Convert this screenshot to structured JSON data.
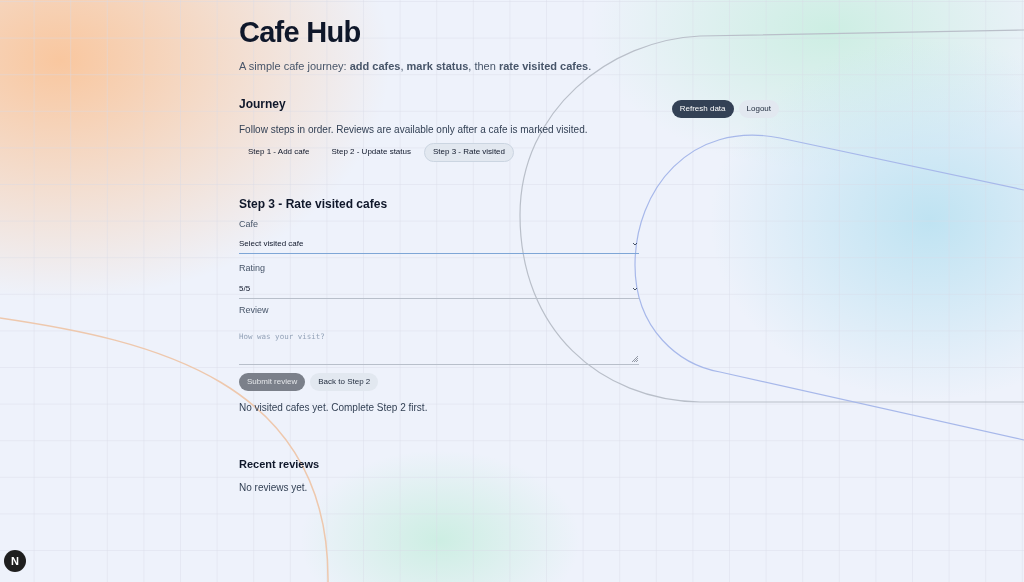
{
  "title": "Cafe Hub",
  "subtitle": "A simple cafe journey: **add cafes**, **mark status**, then **rate visited cafes**.",
  "journey": {
    "heading": "Journey",
    "actions": [
      {
        "label": "Refresh data",
        "kind": "primary"
      },
      {
        "label": "Logout",
        "kind": "secondary"
      }
    ],
    "hint": "Follow steps in order. Reviews are available only after a cafe is marked visited.",
    "steps": [
      {
        "label": "Step 1 - Add cafe",
        "selected": false
      },
      {
        "label": "Step 2 - Update status",
        "selected": false
      },
      {
        "label": "Step 3 - Rate visited",
        "selected": true
      }
    ]
  },
  "form": {
    "heading": "Step 3 - Rate visited cafes",
    "fields": [
      {
        "kind": "select",
        "label": "Cafe",
        "value": "Select visited cafe",
        "focused": true
      },
      {
        "kind": "select",
        "label": "Rating",
        "value": "5/5",
        "focused": false
      },
      {
        "kind": "textarea",
        "label": "Review",
        "placeholder": "How was your visit?"
      }
    ],
    "buttons": [
      {
        "label": "Submit review",
        "disabled": true
      },
      {
        "label": "Back to Step 2",
        "disabled": false
      }
    ],
    "message": "No visited cafes yet. Complete Step 2 first."
  },
  "recent": {
    "heading": "Recent reviews",
    "empty": "No reviews yet."
  },
  "dev_badge": "N"
}
